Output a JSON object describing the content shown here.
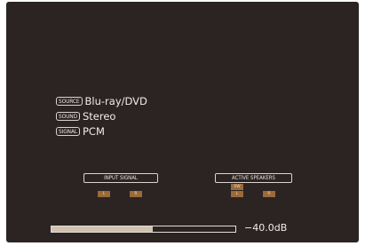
{
  "info": {
    "source": {
      "tag": "SOURCE",
      "value": "Blu-ray/DVD"
    },
    "sound": {
      "tag": "SOUND",
      "value": "Stereo"
    },
    "signal": {
      "tag": "SIGNAL",
      "value": "PCM"
    }
  },
  "input_signal": {
    "label": "INPUT SIGNAL",
    "channels": [
      "L",
      "R"
    ]
  },
  "active_speakers": {
    "label": "ACTIVE SPEAKERS",
    "channels": [
      "SW",
      "L",
      "R"
    ]
  },
  "volume": {
    "text": "−40.0dB",
    "level_fraction": 0.55
  },
  "colors": {
    "background": "#2b2423",
    "channel": "#9a6a3a",
    "volume_fill": "#d2c2ae",
    "text": "#f0ece8"
  }
}
